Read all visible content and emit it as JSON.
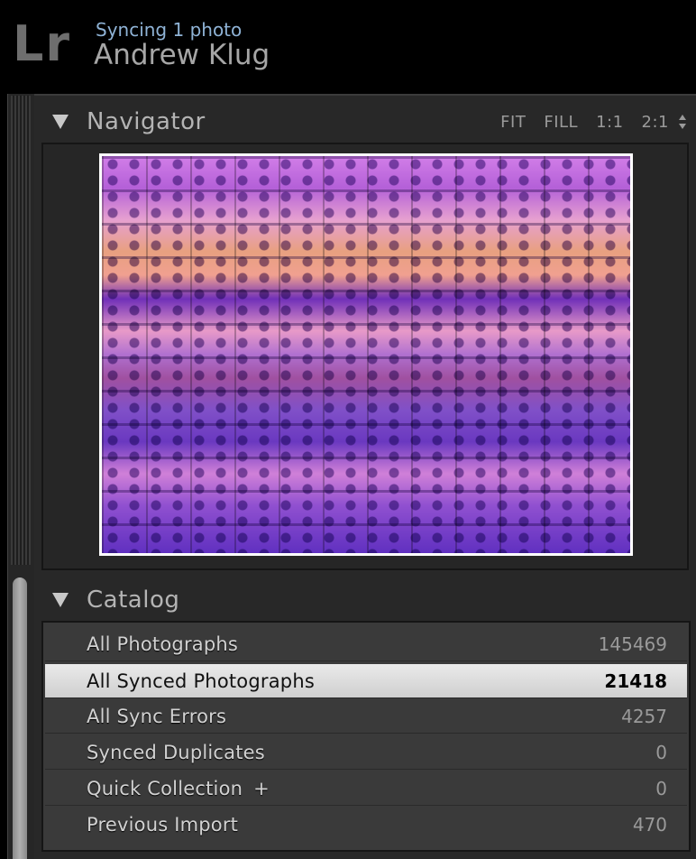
{
  "header": {
    "logo": "Lr",
    "sync_status": "Syncing 1 photo",
    "user_name": "Andrew Klug"
  },
  "navigator": {
    "title": "Navigator",
    "zoom_options": [
      "FIT",
      "FILL",
      "1:1",
      "2:1"
    ]
  },
  "catalog": {
    "title": "Catalog",
    "items": [
      {
        "label": "All Photographs",
        "count": "145469"
      },
      {
        "label": "All Synced Photographs",
        "count": "21418"
      },
      {
        "label": "All Sync Errors",
        "count": "4257"
      },
      {
        "label": "Synced Duplicates",
        "count": "0"
      },
      {
        "label": "Quick Collection",
        "suffix": "+",
        "count": "0"
      },
      {
        "label": "Previous Import",
        "count": "470"
      }
    ],
    "selected_index": 1
  },
  "colors": {
    "selected_row": "#d9d9d9",
    "sync_status": "#8fb3d6",
    "panel_bg": "#282828"
  }
}
